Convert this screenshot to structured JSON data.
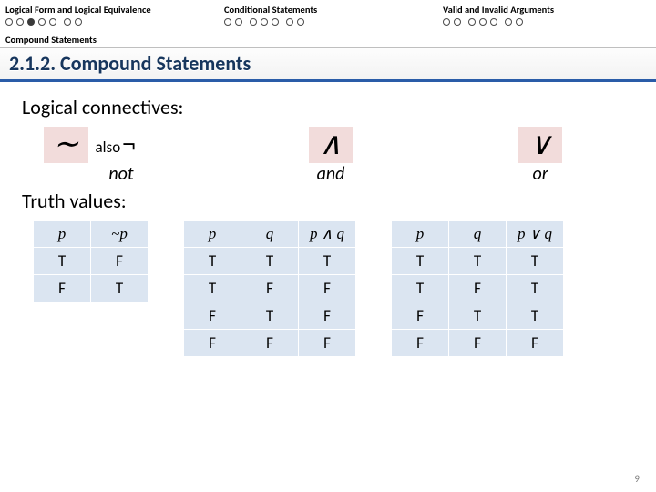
{
  "nav": {
    "tabs": [
      {
        "label": "Logical Form and Logical Equivalence",
        "dots": "oo.ooo.oo",
        "active_index": 2
      },
      {
        "label": "Conditional Statements",
        "dots": "oo.ooo.oo",
        "active_index": -1
      },
      {
        "label": "Valid and Invalid Arguments",
        "dots": "oo.ooo.oo",
        "active_index": -1
      }
    ],
    "subnav": "Compound Statements"
  },
  "title": "2.1.2. Compound Statements",
  "section1": "Logical connectives:",
  "section2": "Truth values:",
  "connectives": {
    "not": {
      "symbol": "∼",
      "also_word": "also",
      "also_sym": "¬",
      "label": "not"
    },
    "and": {
      "symbol": "∧",
      "label": "and"
    },
    "or": {
      "symbol": "∨",
      "label": "or"
    }
  },
  "chart_data": [
    {
      "type": "table",
      "title": "~p truth table",
      "headers": [
        "p",
        "~p"
      ],
      "rows": [
        [
          "T",
          "F"
        ],
        [
          "F",
          "T"
        ]
      ]
    },
    {
      "type": "table",
      "title": "p ∧ q truth table",
      "headers": [
        "p",
        "q",
        "p ∧ q"
      ],
      "rows": [
        [
          "T",
          "T",
          "T"
        ],
        [
          "T",
          "F",
          "F"
        ],
        [
          "F",
          "T",
          "F"
        ],
        [
          "F",
          "F",
          "F"
        ]
      ]
    },
    {
      "type": "table",
      "title": "p ∨ q truth table",
      "headers": [
        "p",
        "q",
        "p ∨ q"
      ],
      "rows": [
        [
          "T",
          "T",
          "T"
        ],
        [
          "T",
          "F",
          "T"
        ],
        [
          "F",
          "T",
          "T"
        ],
        [
          "F",
          "F",
          "F"
        ]
      ]
    }
  ],
  "page_number": "9"
}
